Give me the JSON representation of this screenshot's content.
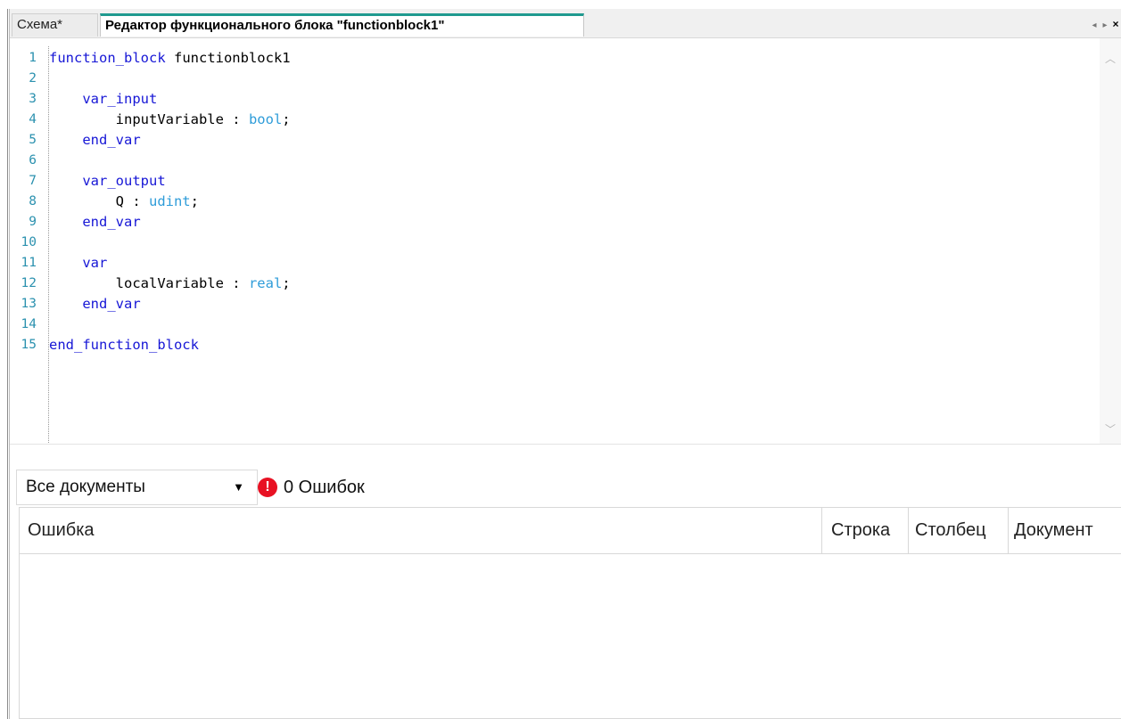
{
  "tabs": {
    "inactive_label": "Схема*",
    "active_label": "Редактор функционального блока \"functionblock1\"",
    "nav_prev": "◂",
    "nav_next": "▸",
    "nav_close": "×"
  },
  "editor": {
    "line_numbers": [
      "1",
      "2",
      "3",
      "4",
      "5",
      "6",
      "7",
      "8",
      "9",
      "10",
      "11",
      "12",
      "13",
      "14",
      "15"
    ],
    "lines": [
      {
        "indent": "",
        "keyword": "function_block",
        "rest": " functionblock1",
        "type": ""
      },
      {
        "indent": "",
        "keyword": "",
        "rest": "",
        "type": ""
      },
      {
        "indent": "    ",
        "keyword": "var_input",
        "rest": "",
        "type": ""
      },
      {
        "indent": "        ",
        "keyword": "",
        "rest": "inputVariable : ",
        "type": "bool",
        "tail": ";"
      },
      {
        "indent": "    ",
        "keyword": "end_var",
        "rest": "",
        "type": ""
      },
      {
        "indent": "",
        "keyword": "",
        "rest": "",
        "type": ""
      },
      {
        "indent": "    ",
        "keyword": "var_output",
        "rest": "",
        "type": ""
      },
      {
        "indent": "        ",
        "keyword": "",
        "rest": "Q : ",
        "type": "udint",
        "tail": ";"
      },
      {
        "indent": "    ",
        "keyword": "end_var",
        "rest": "",
        "type": ""
      },
      {
        "indent": "",
        "keyword": "",
        "rest": "",
        "type": ""
      },
      {
        "indent": "    ",
        "keyword": "var",
        "rest": "",
        "type": ""
      },
      {
        "indent": "        ",
        "keyword": "",
        "rest": "localVariable : ",
        "type": "real",
        "tail": ";"
      },
      {
        "indent": "    ",
        "keyword": "end_var",
        "rest": "",
        "type": ""
      },
      {
        "indent": "",
        "keyword": "",
        "rest": "",
        "type": ""
      },
      {
        "indent": "",
        "keyword": "end_function_block",
        "rest": "",
        "type": ""
      }
    ]
  },
  "error_panel": {
    "filter_selected": "Все документы",
    "error_count_label": "0 Ошибок",
    "columns": {
      "error": "Ошибка",
      "row": "Строка",
      "column": "Столбец",
      "document": "Документ"
    },
    "rows": []
  },
  "colors": {
    "active_tab_accent": "#1f9a8f",
    "keyword": "#1717d6",
    "type": "#2e9cd9",
    "line_number": "#2b91af",
    "error_icon": "#e81123"
  },
  "icons": {
    "error_icon": "error-circle-icon",
    "dropdown": "chevron-down-icon"
  }
}
